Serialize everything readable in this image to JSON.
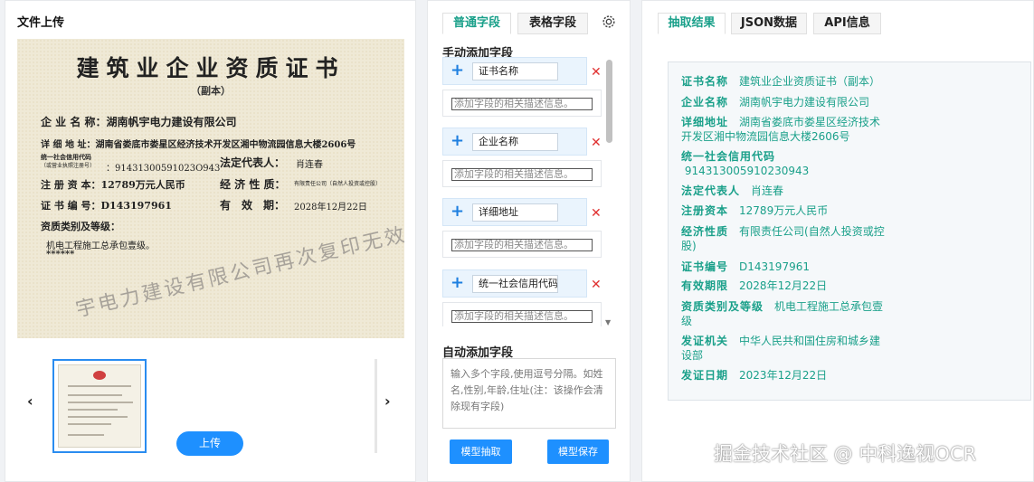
{
  "upload_panel": {
    "title": "文件上传",
    "upload_label": "上传",
    "prev_label": "‹",
    "next_label": "›",
    "certificate": {
      "title": "建筑业企业资质证书",
      "subtitle": "（副本）",
      "company_line": "企 业 名 称：湖南帆宇电力建设有限公司",
      "address_line": "详 细 地 址：湖南省娄底市娄星区经济技术开发区湘中物流园信息大楼2606号",
      "credit_label": "统一社会信用代码",
      "credit_label_sub": "（或营业执照注册号）",
      "credit_value": "：91431300591023O943",
      "legal_rep": "法定代表人：",
      "legal_rep_value": "肖连春",
      "capital_line": "注 册 资 本：12789万元人民币",
      "nature_label": "经 济 性 质：",
      "nature_value": "有限责任公司（自然人投资或控股）",
      "cert_no_line": "证 书 编 号：D143197961",
      "valid_label": "有　效　期：",
      "valid_value": "2028年12月22日",
      "qual_label": "资质类别及等级：",
      "qual_value": "机电工程施工总承包壹级。",
      "stars": "******",
      "watermark": "宇电力建设有限公司再次复印无效"
    }
  },
  "field_panel": {
    "tabs": [
      "普通字段",
      "表格字段"
    ],
    "manual_title": "手动添加字段",
    "fields": [
      "证书名称",
      "企业名称",
      "详细地址",
      "统一社会信用代码"
    ],
    "desc_placeholder": "添加字段的相关描述信息。",
    "auto_title": "自动添加字段",
    "auto_placeholder": "输入多个字段,使用逗号分隔。如姓名,性别,年龄,住址(注：该操作会清除现有字段)",
    "extract_button": "模型抽取",
    "save_button": "模型保存",
    "add_icon": "plus-icon",
    "delete_icon": "close-icon",
    "settings_icon": "gear-icon"
  },
  "result_panel": {
    "tabs": [
      "抽取结果",
      "JSON数据",
      "API信息"
    ],
    "results": [
      {
        "key": "证书名称",
        "value": "建筑业企业资质证书（副本）"
      },
      {
        "key": "企业名称",
        "value": "湖南帆宇电力建设有限公司"
      },
      {
        "key": "详细地址",
        "value": "湖南省娄底市娄星区经济技术\n开发区湘中物流园信息大楼2606号"
      },
      {
        "key": "统一社会信用代码",
        "value": "\n 914313005910230943"
      },
      {
        "key": "法定代表人",
        "value": "肖连春"
      },
      {
        "key": "注册资本",
        "value": "12789万元人民币"
      },
      {
        "key": "经济性质",
        "value": "有限责任公司(自然人投资或控\n股)"
      },
      {
        "key": "证书编号",
        "value": "D143197961"
      },
      {
        "key": "有效期限",
        "value": "2028年12月22日"
      },
      {
        "key": "资质类别及等级",
        "value": "机电工程施工总承包壹\n级"
      },
      {
        "key": "发证机关",
        "value": "中华人民共和国住房和城乡建\n设部"
      },
      {
        "key": "发证日期",
        "value": "2023年12月22日"
      }
    ],
    "accent_color": "#1aa08a"
  },
  "watermark": "掘金技术社区 @ 中科逸视OCR"
}
